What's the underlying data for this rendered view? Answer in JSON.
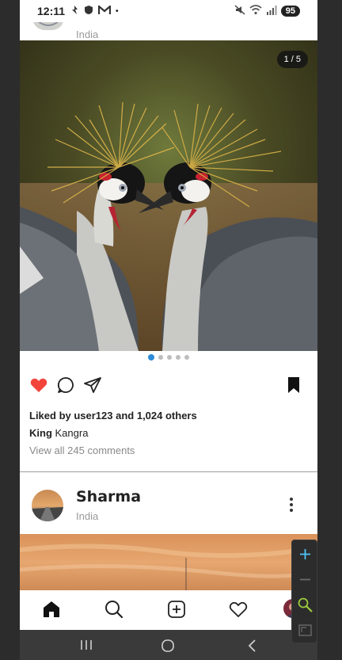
{
  "status_bar": {
    "time": "12:11",
    "icons_left": "g",
    "dot": "•",
    "battery": "95"
  },
  "previous_post": {
    "location": "India"
  },
  "post": {
    "page_counter": "1 / 5",
    "page_count": 5,
    "active_page": 1,
    "liked": true,
    "likes_text": "Liked by user123 and 1,024 others",
    "caption_user": "King",
    "caption_text": "Kangra",
    "view_comments": "View all 245 comments"
  },
  "next_post": {
    "username": "Sharma",
    "location": "India"
  },
  "bottom_nav": {
    "items": [
      "home-icon",
      "search-icon",
      "add-post-icon",
      "activity-heart-icon",
      "profile-avatar"
    ]
  },
  "colors": {
    "like_red": "#f2443b",
    "dot_active": "#2f8bd8",
    "toolbar_bg": "#2c2c2c",
    "toolbar_accent": "#4fc3f7",
    "zoom_green": "#9ccc3c"
  }
}
